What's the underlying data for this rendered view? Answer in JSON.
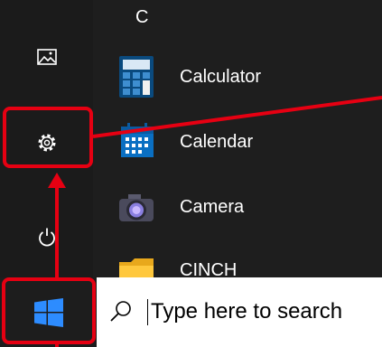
{
  "start_menu": {
    "section_letter": "C",
    "rail": [
      {
        "name": "pictures",
        "icon": "pictures-icon"
      },
      {
        "name": "settings",
        "icon": "gear-icon"
      },
      {
        "name": "power",
        "icon": "power-icon"
      }
    ],
    "apps": [
      {
        "label": "Calculator",
        "icon": "calculator-icon"
      },
      {
        "label": "Calendar",
        "icon": "calendar-icon"
      },
      {
        "label": "Camera",
        "icon": "camera-icon"
      },
      {
        "label": "CINCH",
        "icon": "folder-icon"
      }
    ]
  },
  "taskbar": {
    "start_icon": "windows-logo-icon",
    "search_placeholder": "Type here to search",
    "search_icon": "search-icon"
  },
  "colors": {
    "menu_bg": "#1e1e1e",
    "annotation": "#e60012",
    "accent_blue": "#0078d7"
  }
}
